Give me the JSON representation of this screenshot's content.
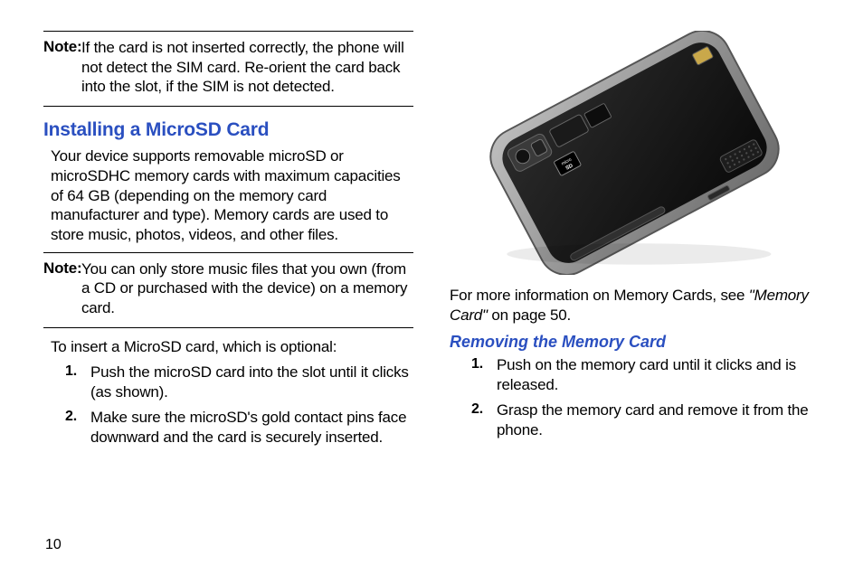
{
  "leftColumn": {
    "note1": {
      "label": "Note:",
      "text": "If the card is not inserted correctly, the phone will not detect the SIM card. Re-orient the card back into the slot, if the SIM is not detected."
    },
    "heading": "Installing a MicroSD Card",
    "intro": "Your device supports removable microSD or microSDHC memory cards with maximum capacities of 64 GB (depending on the memory card manufacturer and type). Memory cards are used to store music, photos, videos, and other files.",
    "note2": {
      "label": "Note:",
      "text": "You can only store music files that you own (from a CD or purchased with the device) on a memory card."
    },
    "insertLead": "To insert a MicroSD card, which is optional:",
    "steps": [
      {
        "num": "1.",
        "text": "Push the microSD card into the slot until it clicks (as shown)."
      },
      {
        "num": "2.",
        "text": "Make sure the microSD's gold contact pins face downward and the card is securely inserted."
      }
    ]
  },
  "rightColumn": {
    "reference": {
      "pre": "For more information on Memory Cards, see ",
      "refTitle": "\"Memory Card\"",
      "post": " on page 50."
    },
    "subheading": "Removing the Memory Card",
    "steps": [
      {
        "num": "1.",
        "text": "Push on the memory card until it clicks and is released."
      },
      {
        "num": "2.",
        "text": "Grasp the memory card and remove it from the phone."
      }
    ]
  },
  "pageNumber": "10",
  "figure": {
    "alt": "phone-back-microsd-slot-illustration",
    "sdLabel": "micro SD"
  }
}
